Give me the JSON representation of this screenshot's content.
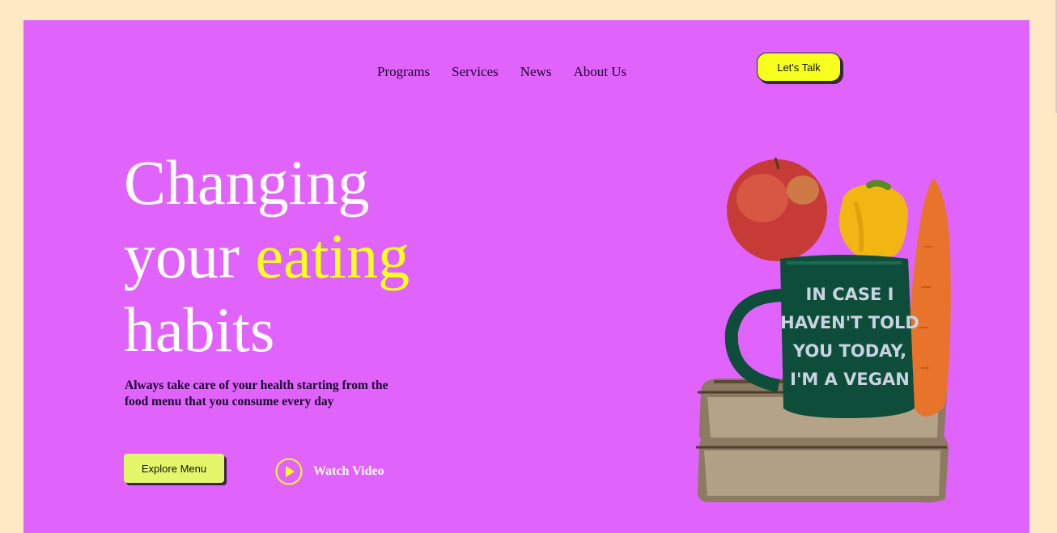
{
  "nav": {
    "items": [
      "Programs",
      "Services",
      "News",
      "About Us"
    ],
    "cta_label": "Let's Talk"
  },
  "hero": {
    "headline_line1": "Changing",
    "headline_line2_prefix": "your ",
    "headline_line2_accent": "eating",
    "headline_line3": "habits",
    "subtext": "Always take care of your health starting from the food menu that you consume every day",
    "explore_label": "Explore Menu",
    "watch_label": "Watch Video"
  },
  "mug": {
    "line1": "IN CASE I",
    "line2": "HAVEN'T TOLD",
    "line3": "YOU TODAY,",
    "line4": "I'M A VEGAN"
  },
  "colors": {
    "page_background": "#ffe8c4",
    "hero_background": "#e063fb",
    "accent_yellow": "#f6ff1e",
    "button_lime": "#e4f76a",
    "text_dark": "#1c0630",
    "text_light": "#ffffff"
  },
  "icons": [
    "play-icon"
  ]
}
